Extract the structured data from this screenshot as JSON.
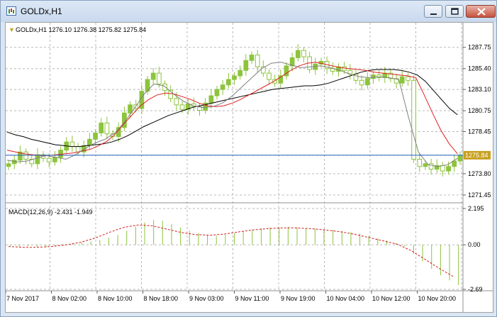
{
  "window": {
    "title": "GOLDx,H1",
    "buttons": [
      "minimize",
      "restore",
      "close"
    ]
  },
  "chart_header": {
    "text": "GOLDx,H1  1276.10 1276.38 1275.82 1275.84"
  },
  "price_label": "1275.84",
  "colors": {
    "candle": "#8cc43c",
    "ma_fast": "#808080",
    "ma_mid": "#e02020",
    "ma_slow": "#000000",
    "macd_hist": "#8cc43c",
    "macd_signal": "#d02020",
    "price_line": "#2060c0",
    "price_tag": "#c8a020",
    "grid": "#b8b8b8"
  },
  "chart_data": [
    {
      "type": "candlestick",
      "title": "GOLDx,H1",
      "ylim": [
        1270.9,
        1288.9
      ],
      "y_ticks": [
        "1287.75",
        "1285.40",
        "1283.10",
        "1280.75",
        "1278.45",
        "1275.84",
        "1273.80",
        "1271.45"
      ],
      "x_ticks": [
        "7 Nov 2017",
        "8 Nov 02:00",
        "8 Nov 10:00",
        "8 Nov 18:00",
        "9 Nov 03:00",
        "9 Nov 11:00",
        "9 Nov 19:00",
        "10 Nov 04:00",
        "10 Nov 12:00",
        "10 Nov 20:00"
      ],
      "closes": [
        1274.9,
        1275.3,
        1276.2,
        1275.4,
        1274.9,
        1275.9,
        1275.5,
        1275.1,
        1275.6,
        1276.4,
        1277.3,
        1276.8,
        1276.2,
        1276.9,
        1277.6,
        1278.3,
        1279.4,
        1278.2,
        1277.9,
        1278.9,
        1280.5,
        1281.4,
        1281.0,
        1282.9,
        1284.2,
        1284.9,
        1283.7,
        1283.0,
        1282.1,
        1281.4,
        1280.9,
        1281.5,
        1281.2,
        1280.8,
        1281.6,
        1282.4,
        1283.1,
        1283.6,
        1284.2,
        1284.6,
        1285.2,
        1286.3,
        1286.9,
        1285.6,
        1284.9,
        1284.2,
        1283.8,
        1284.6,
        1285.7,
        1286.6,
        1287.4,
        1286.7,
        1285.3,
        1285.9,
        1286.2,
        1285.4,
        1285.1,
        1285.6,
        1285.2,
        1284.8,
        1284.1,
        1283.6,
        1284.3,
        1284.7,
        1284.4,
        1284.9,
        1284.3,
        1283.8,
        1284.5,
        1284.1,
        1275.4,
        1274.6,
        1274.9,
        1274.3,
        1274.7,
        1274.1,
        1274.6,
        1275.2,
        1275.84
      ],
      "ma_slow": [
        1278.4,
        1278.1,
        1277.9,
        1277.6,
        1277.4,
        1277.2,
        1277.0,
        1276.9,
        1276.8,
        1276.8,
        1276.9,
        1277.0,
        1277.1,
        1277.3,
        1277.6,
        1278.0,
        1278.5,
        1279.0,
        1279.4,
        1279.8,
        1280.2,
        1280.5,
        1280.8,
        1281.1,
        1281.3,
        1281.5,
        1281.7,
        1281.9,
        1282.1,
        1282.3,
        1282.5,
        1282.7,
        1282.9,
        1283.1,
        1283.2,
        1283.3,
        1283.4,
        1283.5,
        1283.5,
        1283.6,
        1283.8,
        1284.1,
        1284.4,
        1284.7,
        1285.0,
        1285.2,
        1285.3,
        1285.3,
        1285.3,
        1285.2,
        1285.0,
        1284.7,
        1284.0,
        1283.0,
        1282.0,
        1281.0,
        1280.3
      ],
      "ma_mid": [
        1276.4,
        1276.2,
        1276.0,
        1275.9,
        1275.8,
        1275.8,
        1275.9,
        1276.0,
        1276.1,
        1276.3,
        1276.5,
        1276.9,
        1277.4,
        1278.2,
        1279.3,
        1280.3,
        1281.3,
        1282.0,
        1282.5,
        1282.7,
        1282.6,
        1282.3,
        1282.0,
        1281.6,
        1281.3,
        1281.2,
        1281.3,
        1281.6,
        1282.0,
        1282.5,
        1283.0,
        1283.5,
        1284.0,
        1284.6,
        1285.2,
        1285.7,
        1286.0,
        1286.1,
        1285.9,
        1285.7,
        1285.5,
        1285.4,
        1285.3,
        1285.2,
        1285.0,
        1284.9,
        1284.8,
        1284.7,
        1284.6,
        1284.4,
        1282.5,
        1280.5,
        1278.6,
        1277.1,
        1276.0
      ],
      "ma_fast": [
        1275.3,
        1275.1,
        1275.2,
        1275.5,
        1275.8,
        1275.6,
        1275.4,
        1275.9,
        1276.6,
        1277.2,
        1277.6,
        1278.3,
        1279.5,
        1281.0,
        1282.6,
        1283.7,
        1283.5,
        1282.6,
        1281.8,
        1281.3,
        1281.1,
        1281.2,
        1281.6,
        1282.4,
        1283.4,
        1284.4,
        1285.4,
        1286.0,
        1286.1,
        1285.8,
        1285.5,
        1285.6,
        1285.7,
        1285.5,
        1285.2,
        1284.8,
        1284.5,
        1284.4,
        1284.5,
        1284.4,
        1284.2,
        1280.0,
        1276.2,
        1274.8,
        1274.6,
        1274.8,
        1275.5
      ]
    },
    {
      "type": "bar",
      "title": "MACD(12,26,9) -2.431 -1.949",
      "ylim": [
        -2.69,
        2.195
      ],
      "y_ticks": [
        "2.195",
        "0.00",
        "-2.69"
      ],
      "values": [
        -0.05,
        -0.1,
        -0.08,
        -0.12,
        -0.15,
        -0.1,
        -0.05,
        0.05,
        0.12,
        0.2,
        0.3,
        0.42,
        0.6,
        0.85,
        1.1,
        1.35,
        1.5,
        1.45,
        1.25,
        1.05,
        0.85,
        0.7,
        0.6,
        0.55,
        0.6,
        0.7,
        0.8,
        0.9,
        1.0,
        1.05,
        1.08,
        1.1,
        1.05,
        1.0,
        0.98,
        0.95,
        0.9,
        0.85,
        0.78,
        0.68,
        0.55,
        0.4,
        0.25,
        0.1,
        -0.1,
        -0.55,
        -1.0,
        -1.45,
        -1.85,
        -2.15,
        -2.43
      ],
      "signal": [
        -0.1,
        -0.15,
        -0.15,
        -0.1,
        0.0,
        0.15,
        0.4,
        0.75,
        1.05,
        1.2,
        1.15,
        0.95,
        0.75,
        0.62,
        0.58,
        0.65,
        0.78,
        0.9,
        0.98,
        1.02,
        1.02,
        0.98,
        0.9,
        0.8,
        0.65,
        0.45,
        0.25,
        0.05,
        -0.35,
        -0.9,
        -1.45,
        -1.95
      ]
    }
  ]
}
